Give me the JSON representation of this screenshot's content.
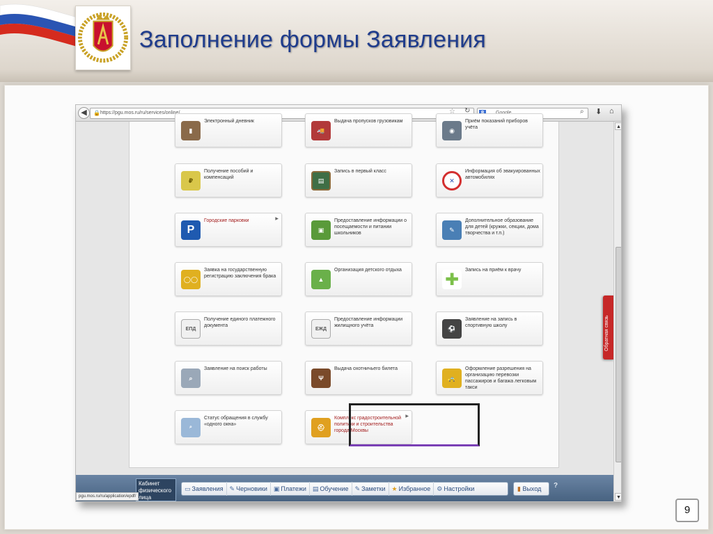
{
  "slide": {
    "title": "Заполнение формы Заявления",
    "page_number": "9"
  },
  "browser": {
    "url": "https://pgu.mos.ru/ru/services/online/",
    "search_placeholder": "Google",
    "status_url": "pgu.mos.ru/ru/application/epdf/"
  },
  "services": [
    {
      "label": "Электронный дневник",
      "icon": "diary-icon"
    },
    {
      "label": "Выдача пропусков грузовикам",
      "icon": "truck-icon"
    },
    {
      "label": "Приём показаний приборов учёта",
      "icon": "meter-icon"
    },
    {
      "label": "Получение пособий и компенсаций",
      "icon": "money-icon"
    },
    {
      "label": "Запись в первый класс",
      "icon": "blackboard-icon"
    },
    {
      "label": "Информация об эвакуированных автомобилях",
      "icon": "no-parking-icon"
    },
    {
      "label": "Городские парковки",
      "icon": "parking-icon"
    },
    {
      "label": "Предоставление информации о посещаемости и питании школьников",
      "icon": "backpack-icon"
    },
    {
      "label": "Дополнительное образование для детей (кружки, секции, дома творчества и т.п.)",
      "icon": "student-desk-icon"
    },
    {
      "label": "Заявка на государственную регистрацию заключения брака",
      "icon": "rings-icon"
    },
    {
      "label": "Организация детского отдыха",
      "icon": "landscape-icon"
    },
    {
      "label": "Запись на приём к врачу",
      "icon": "medical-cross-icon"
    },
    {
      "label": "Получение единого платежного документа",
      "icon": "epd-document-icon"
    },
    {
      "label": "Предоставление информации жилищного учёта",
      "icon": "ezhd-document-icon"
    },
    {
      "label": "Заявление на запись в спортивную школу",
      "icon": "sport-balls-icon"
    },
    {
      "label": "Заявление на поиск работы",
      "icon": "job-search-icon"
    },
    {
      "label": "Выдача охотничьего билета",
      "icon": "deer-icon"
    },
    {
      "label": "Оформление разрешения на организацию перевозки пассажиров и багажа легковым такси",
      "icon": "taxi-icon"
    },
    {
      "label": "Статус обращения в службу «одного окна»",
      "icon": "one-window-icon"
    },
    {
      "label": "Комплекс градостроительной политики и строительства города Москвы",
      "icon": "construction-icon"
    }
  ],
  "feedback_tab": "Обратная связь",
  "cabinet_label": "Кабинет физического лица",
  "menu": [
    {
      "label": "Заявления",
      "icon": "applications-icon"
    },
    {
      "label": "Черновики",
      "icon": "drafts-icon"
    },
    {
      "label": "Платежи",
      "icon": "payments-icon"
    },
    {
      "label": "Обучение",
      "icon": "learning-icon"
    },
    {
      "label": "Заметки",
      "icon": "notes-icon"
    },
    {
      "label": "Избранное",
      "icon": "favorites-icon"
    },
    {
      "label": "Настройки",
      "icon": "settings-icon"
    }
  ],
  "exit_label": "Выход",
  "colors": {
    "title_blue": "#1f3c8c",
    "link_red": "#a31d1d",
    "feedback_red": "#c62828",
    "highlight_purple": "#7a3fb5"
  }
}
